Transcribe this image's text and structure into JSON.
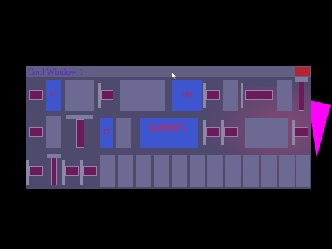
{
  "window": {
    "title": "Cool Window 1",
    "accent": "#5a28d8",
    "close_color": "#b3262f",
    "background": "#4d4a6e"
  },
  "labels": {
    "center_label": "Label",
    "small_glyph_a": "M",
    "small_glyph_b": "A",
    "small_glyph_c": "ON",
    "small_glyph_d": "D"
  },
  "decor": {
    "magenta": "#ff00ff",
    "icons": [
      "cursor-arrow-icon",
      "close-icon"
    ]
  }
}
